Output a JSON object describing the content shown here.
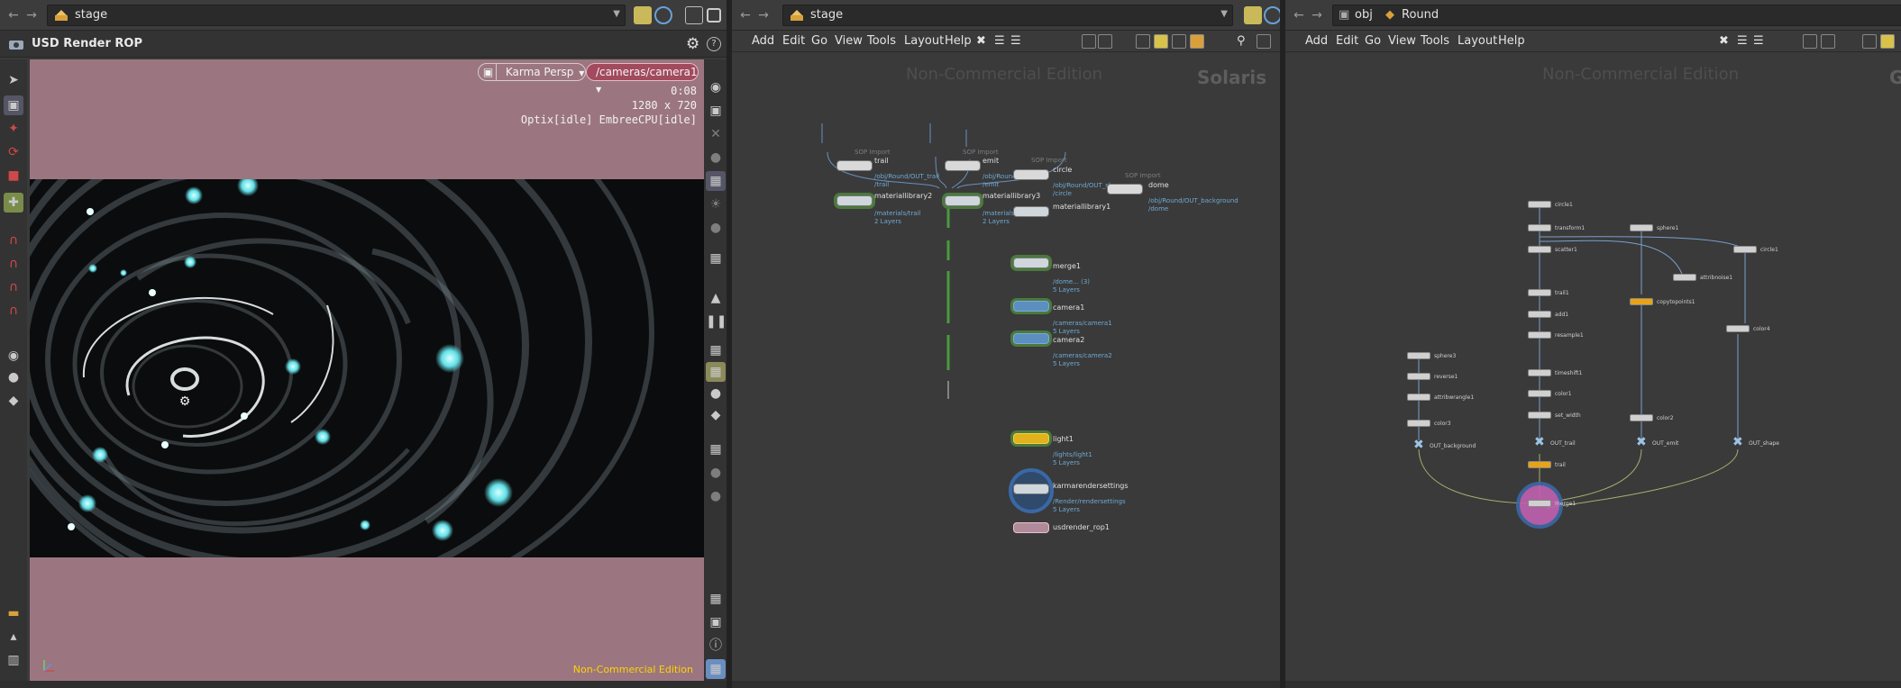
{
  "left_pane": {
    "path": "stage",
    "tool_title": "USD Render ROP",
    "viewport": {
      "camera_menu": "Karma Persp",
      "camera_path": "/cameras/camera1",
      "time": "0:08",
      "resolution": "1280 x 720",
      "renderer_status": "Optix[idle] EmbreeCPU[idle]",
      "edition": "Non-Commercial Edition"
    }
  },
  "mid_pane": {
    "path": "stage",
    "menu": [
      "Add",
      "Edit",
      "Go",
      "View",
      "Tools",
      "Layout",
      "Help"
    ],
    "watermark": "Non-Commercial Edition",
    "context": "Solaris",
    "nodes": {
      "trail": {
        "type": "SOP Import",
        "name": "trail",
        "sub": "/obj/Round/OUT_trail\n/trail"
      },
      "emit": {
        "type": "SOP Import",
        "name": "emit",
        "sub": "/obj/Round/OUT...\n/emit"
      },
      "circle": {
        "type": "SOP Import",
        "name": "circle",
        "sub": "/obj/Round/OUT_sh...\n/circle"
      },
      "dome": {
        "type": "SOP Import",
        "name": "dome",
        "sub": "/obj/Round/OUT_background\n/dome"
      },
      "matlib2": {
        "name": "materiallibrary2",
        "sub": "/materials/trail\n2 Layers"
      },
      "matlib3": {
        "name": "materiallibrary3",
        "sub": "/materials/...\n2 Layers"
      },
      "matlib1": {
        "name": "materiallibrary1",
        "sub": ""
      },
      "merge1": {
        "name": "merge1",
        "sub": "/dome... (3)\n5 Layers"
      },
      "camera1": {
        "name": "camera1",
        "sub": "/cameras/camera1\n5 Layers"
      },
      "camera2": {
        "name": "camera2",
        "sub": "/cameras/camera2\n5 Layers"
      },
      "light1": {
        "name": "light1",
        "sub": "/lights/light1\n5 Layers"
      },
      "karma": {
        "name": "karmarendersettings",
        "sub": "/Render/rendersettings\n5 Layers"
      },
      "rop": {
        "name": "usdrender_rop1"
      }
    }
  },
  "right_pane": {
    "path_root": "obj",
    "path_child": "Round",
    "menu": [
      "Add",
      "Edit",
      "Go",
      "View",
      "Tools",
      "Layout",
      "Help"
    ],
    "watermark": "Non-Commercial Edition",
    "context": "G",
    "nodes": {
      "circle1": "circle1",
      "transform1": "transform1",
      "scatter1": "scatter1",
      "sphere1": "sphere1",
      "attribnoise1": "attribnoise1",
      "trail1": "trail1",
      "add1": "add1",
      "resample1": "resample1",
      "copytopoints1": "copytopoints1",
      "timeshift": "timeshift1",
      "color1": "color1",
      "set_width": "set_width",
      "out_trail": "OUT_trail",
      "color2": "color2",
      "out_emit": "OUT_emit",
      "color4": "color4",
      "out_shape": "OUT_shape",
      "sphere3": "sphere3",
      "reverse1": "reverse1",
      "attribwrangle": "attribwrangle1",
      "color3": "color3",
      "out_background": "OUT_background",
      "trail2": "trail",
      "merge1": "merge1",
      "circle2": "circle1"
    }
  },
  "colors": {
    "viewport_bg": "#9b7680",
    "accent_blue": "#5d8ec0",
    "accent_yellow": "#e0b21c",
    "edition_text": "#ffd200"
  }
}
